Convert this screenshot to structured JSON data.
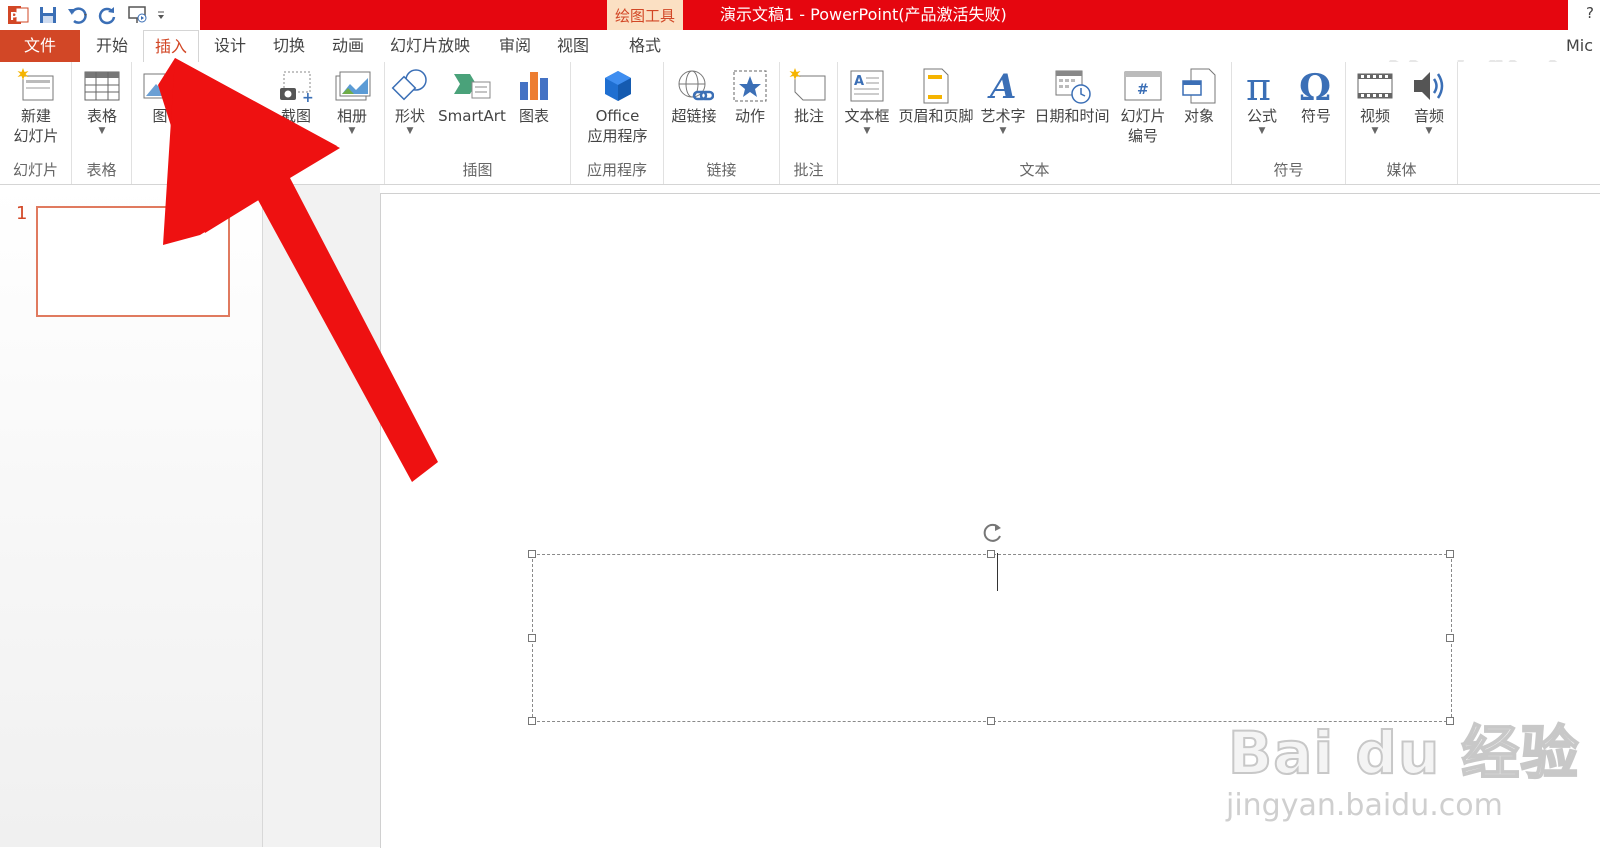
{
  "titlebar": {
    "contextual_tab": "绘图工具",
    "document_title": "演示文稿1 -  PowerPoint(产品激活失败)",
    "help": "?"
  },
  "tabs": [
    {
      "id": "file",
      "label": "文件"
    },
    {
      "id": "home",
      "label": "开始"
    },
    {
      "id": "insert",
      "label": "插入",
      "active": true
    },
    {
      "id": "design",
      "label": "设计"
    },
    {
      "id": "transitions",
      "label": "切换"
    },
    {
      "id": "animations",
      "label": "动画"
    },
    {
      "id": "slideshow",
      "label": "幻灯片放映"
    },
    {
      "id": "review",
      "label": "审阅"
    },
    {
      "id": "view",
      "label": "视图"
    },
    {
      "id": "format",
      "label": "格式"
    }
  ],
  "account": "Mic",
  "ribbon": {
    "groups": {
      "slides": "幻灯片",
      "tables": "表格",
      "images": "",
      "illustrations": "插图",
      "apps": "应用程序",
      "links": "链接",
      "comments": "批注",
      "text": "文本",
      "symbols": "符号",
      "media": "媒体"
    },
    "commands": {
      "new_slide_1": "新建",
      "new_slide_2": "幻灯片",
      "table": "表格",
      "pictures": "图",
      "screenshot": "截图",
      "album": "相册",
      "shapes": "形状",
      "smartart": "SmartArt",
      "chart": "图表",
      "office_1": "Office",
      "office_2": "应用程序",
      "hyperlink": "超链接",
      "action": "动作",
      "comment": "批注",
      "textbox": "文本框",
      "header_footer": "页眉和页脚",
      "wordart": "艺术字",
      "datetime": "日期和时间",
      "slide_number_1": "幻灯片",
      "slide_number_2": "编号",
      "object": "对象",
      "equation": "公式",
      "symbol": "符号",
      "video": "视频",
      "audio": "音频"
    }
  },
  "thumbnails": {
    "slide_number": "1"
  },
  "watermark": {
    "brand": "Bai  du 经验",
    "url": "jingyan.baidu.com"
  },
  "colors": {
    "accent": "#d24726",
    "title_red": "#e5060f",
    "arrow_red": "#ee1111"
  }
}
